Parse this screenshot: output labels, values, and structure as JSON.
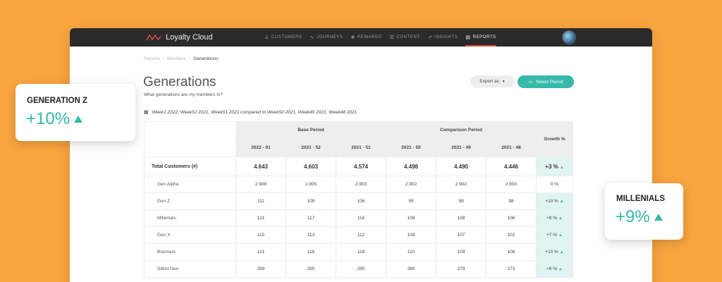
{
  "app": {
    "name": "Loyalty Cloud"
  },
  "nav": [
    {
      "label": "CUSTOMERS",
      "icon": "user-icon",
      "glyph": "♙"
    },
    {
      "label": "JOURNEYS",
      "icon": "pulse-icon",
      "glyph": "∿"
    },
    {
      "label": "REWARDS",
      "icon": "gift-icon",
      "glyph": "❀"
    },
    {
      "label": "CONTENT",
      "icon": "document-icon",
      "glyph": "☰"
    },
    {
      "label": "INSIGHTS",
      "icon": "trend-icon",
      "glyph": "↗"
    },
    {
      "label": "REPORTS",
      "icon": "report-icon",
      "glyph": "▤",
      "active": true
    }
  ],
  "breadcrumb": [
    "Reports",
    "Members",
    "Generations"
  ],
  "page": {
    "title": "Generations",
    "subtitle": "What generations are my members in?",
    "export_label": "Export as",
    "select_period_label": "Select Period",
    "period_text": "Week1 2022, Week52 2021, Week51 2021 compared to Week50 2021, Week49 2021, Week48 2021"
  },
  "table": {
    "base_header": "Base Period",
    "comparison_header": "Comparison Period",
    "growth_header": "Growth %",
    "columns": [
      "2022 - 01",
      "2021 - 52",
      "2021 - 51",
      "2021 - 50",
      "2021 - 49",
      "2021 - 48"
    ],
    "total": {
      "label": "Total Customers (#)",
      "values": [
        "4.643",
        "4.603",
        "4.574",
        "4.498",
        "4.490",
        "4.446"
      ],
      "growth": "+3 %"
    },
    "rows": [
      {
        "label": "Gen Alpha",
        "values": [
          "2.908",
          "2.905",
          "2.903",
          "2.902",
          "2.902",
          "2.900"
        ],
        "growth": "0 %"
      },
      {
        "label": "Gen Z",
        "values": [
          "111",
          "109",
          "106",
          "99",
          "99",
          "98"
        ],
        "growth": "+10 %"
      },
      {
        "label": "Millenials",
        "values": [
          "121",
          "117",
          "114",
          "108",
          "108",
          "106"
        ],
        "growth": "+9 %"
      },
      {
        "label": "Gen X",
        "values": [
          "115",
          "113",
          "112",
          "108",
          "107",
          "102"
        ],
        "growth": "+7 %"
      },
      {
        "label": "Boomers",
        "values": [
          "121",
          "118",
          "118",
          "110",
          "109",
          "106"
        ],
        "growth": "+10 %"
      },
      {
        "label": "Silent Gen",
        "values": [
          "299",
          "295",
          "290",
          "280",
          "279",
          "273"
        ],
        "growth": "+6 %"
      }
    ]
  },
  "cards": {
    "genz": {
      "title": "GENERATION Z",
      "value": "+10%"
    },
    "millenials": {
      "title": "MILLENIALS",
      "value": "+9%"
    }
  },
  "colors": {
    "background": "#f9a53f",
    "accent": "#36b9a9",
    "topbar": "#2b2b2b",
    "nav_active": "#e2523e"
  }
}
